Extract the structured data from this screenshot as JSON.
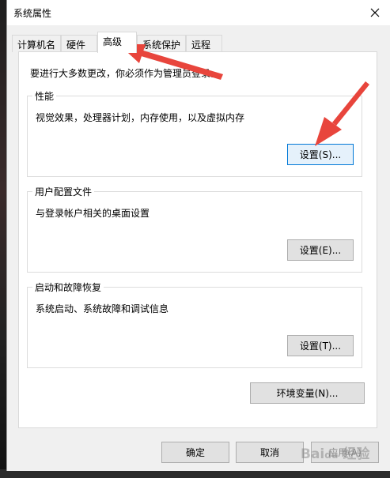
{
  "window": {
    "title": "系统属性"
  },
  "tabs": [
    {
      "label": "计算机名"
    },
    {
      "label": "硬件"
    },
    {
      "label": "高级"
    },
    {
      "label": "系统保护"
    },
    {
      "label": "远程"
    }
  ],
  "active_tab": "高级",
  "notice": "要进行大多数更改，你必须作为管理员登录。",
  "groups": {
    "performance": {
      "title": "性能",
      "description": "视觉效果，处理器计划，内存使用，以及虚拟内存",
      "button": "设置(S)..."
    },
    "user_profiles": {
      "title": "用户配置文件",
      "description": "与登录帐户相关的桌面设置",
      "button": "设置(E)..."
    },
    "startup_recovery": {
      "title": "启动和故障恢复",
      "description": "系统启动、系统故障和调试信息",
      "button": "设置(T)..."
    }
  },
  "env_button": "环境变量(N)...",
  "footer": {
    "ok": "确定",
    "cancel": "取消",
    "apply": "应用(A)"
  },
  "annotation_color": "#e8453c"
}
